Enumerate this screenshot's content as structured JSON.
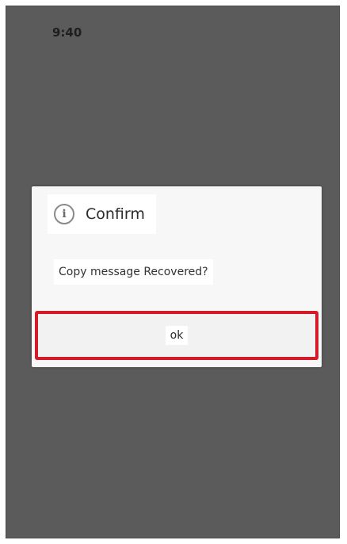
{
  "status_bar": {
    "text": "9:40"
  },
  "dialog": {
    "icon": "info-icon",
    "title": "Confirm",
    "message": "Copy message Recovered?",
    "ok_label": "ok",
    "highlight_color": "#d41b2a"
  }
}
